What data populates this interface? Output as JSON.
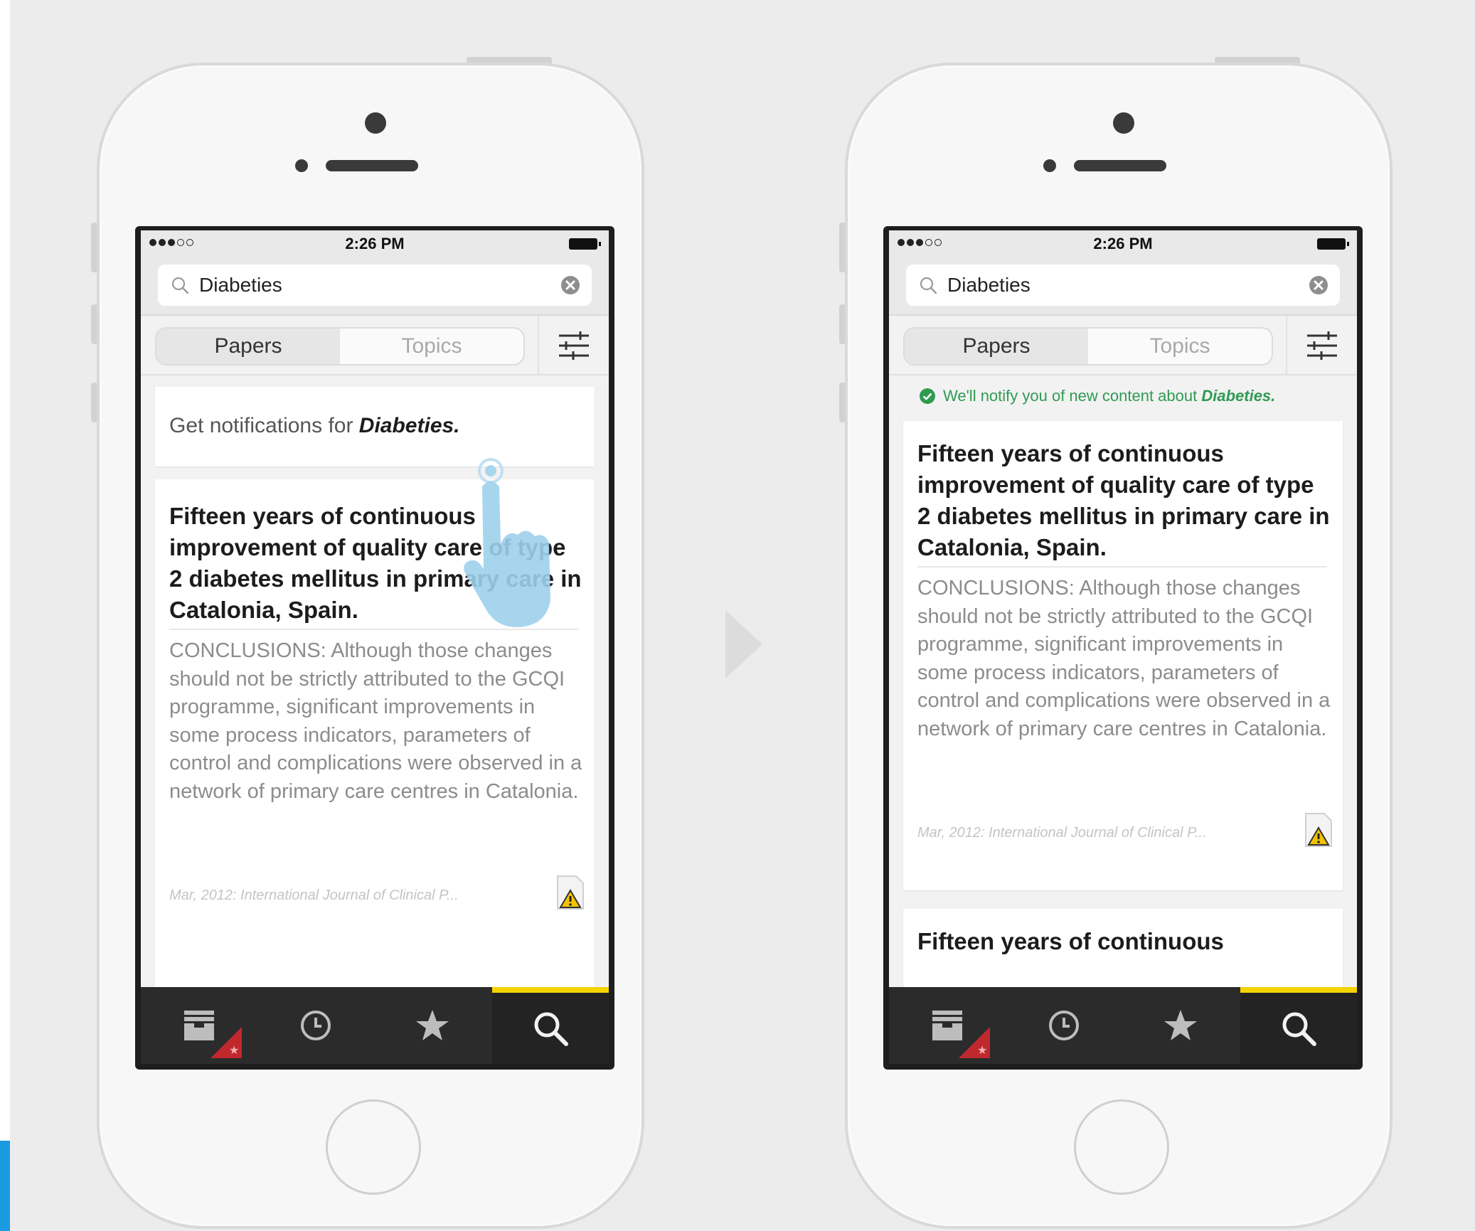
{
  "status_bar": {
    "time": "2:26 PM"
  },
  "search": {
    "query": "Diabeties"
  },
  "segments": {
    "papers": "Papers",
    "topics": "Topics",
    "selected": "Papers"
  },
  "notify_prompt": {
    "prefix": "Get notifications for ",
    "topic": "Diabeties."
  },
  "notify_confirmation": {
    "prefix": "We'll notify you of new content about ",
    "topic": "Diabeties."
  },
  "paper": {
    "title": "Fifteen years of continuous improvement of quality care of type 2 diabetes mellitus in primary care in Catalonia, Spain.",
    "abstract": "CONCLUSIONS: Although those changes should not be strictly attributed to the GCQI programme, significant improvements in some process indicators, parameters of control and complications were observed in a network of primary care centres in Catalonia.",
    "meta": "Mar, 2012: International Journal of Clinical P..."
  },
  "next_paper_title_partial": "Fifteen years of continuous",
  "tabbar": {
    "items": [
      {
        "icon": "inbox-icon"
      },
      {
        "icon": "clock-icon"
      },
      {
        "icon": "star-icon"
      },
      {
        "icon": "search-icon"
      }
    ],
    "active": "search-icon",
    "accent_color": "#f5d300",
    "badge_color": "#c0282e",
    "badge_glyph": "★"
  },
  "colors": {
    "confirmation_green": "#2f9a52"
  }
}
